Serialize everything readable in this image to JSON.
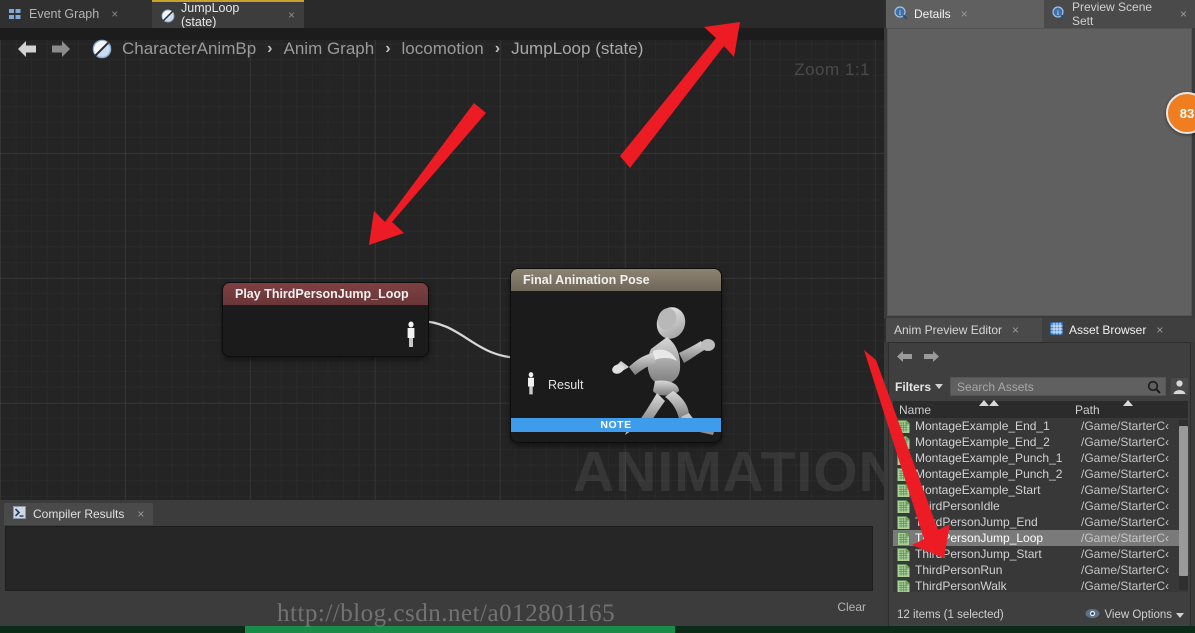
{
  "window": {
    "app": "Unreal Engine Animation Blueprint Editor"
  },
  "editor_tabs": [
    {
      "label": "Event Graph",
      "icon": "graph-grid-icon",
      "active": false,
      "close": "×"
    },
    {
      "label": "JumpLoop (state)",
      "icon": "state-circle-icon",
      "active": true,
      "close": "×"
    }
  ],
  "toolbar": {
    "back_icon": "back-arrow-icon",
    "forward_icon": "forward-arrow-icon",
    "zoom_label": "Zoom 1:1"
  },
  "breadcrumb": {
    "icon": "anim-blueprint-icon",
    "separator": "›",
    "items": [
      "CharacterAnimBp",
      "Anim Graph",
      "locomotion",
      "JumpLoop (state)"
    ]
  },
  "graph": {
    "watermark": "ANIMATION",
    "nodes": [
      {
        "id": "play-node",
        "title": "Play ThirdPersonJump_Loop",
        "output_pin": "pose-pin-icon"
      },
      {
        "id": "final-pose-node",
        "title": "Final Animation Pose",
        "input_pin_label": "Result",
        "input_pin": "pose-pin-icon",
        "footer_label": "NOTE",
        "footer_color": "#3f9bec",
        "preview": "running-mannequin"
      }
    ]
  },
  "compiler_results": {
    "tab_label": "Compiler Results",
    "tab_icon": "console-icon",
    "close": "×",
    "log_text": "",
    "clear_label": "Clear"
  },
  "details_panel": {
    "tabs": [
      {
        "label": "Details",
        "icon": "info-search-icon",
        "active": true,
        "close": "×"
      },
      {
        "label": "Preview Scene Sett",
        "icon": "info-search-icon",
        "active": false,
        "close": "×"
      }
    ],
    "content": ""
  },
  "badge": {
    "value": "83",
    "color": "#f07d20"
  },
  "asset_browser": {
    "tabs": [
      {
        "label": "Anim Preview Editor",
        "icon": "",
        "active": false,
        "close": "×"
      },
      {
        "label": "Asset Browser",
        "icon": "asset-grid-icon",
        "active": true,
        "close": "×"
      }
    ],
    "nav": {
      "back_icon": "back-arrow-icon",
      "forward_icon": "forward-arrow-icon"
    },
    "filters_label": "Filters",
    "search_placeholder": "Search Assets",
    "search_value": "",
    "search_icon": "magnifier-icon",
    "user_icon": "user-icon",
    "columns": [
      {
        "label": "Name",
        "sort": "ascending"
      },
      {
        "label": "Path",
        "sort": "ascending"
      }
    ],
    "rows": [
      {
        "name": "MontageExample_End_1",
        "path": "/Game/StarterC‹",
        "selected": false
      },
      {
        "name": "MontageExample_End_2",
        "path": "/Game/StarterC‹",
        "selected": false
      },
      {
        "name": "MontageExample_Punch_1",
        "path": "/Game/StarterC‹",
        "selected": false
      },
      {
        "name": "MontageExample_Punch_2",
        "path": "/Game/StarterC‹",
        "selected": false
      },
      {
        "name": "MontageExample_Start",
        "path": "/Game/StarterC‹",
        "selected": false
      },
      {
        "name": "ThirdPersonIdle",
        "path": "/Game/StarterC‹",
        "selected": false
      },
      {
        "name": "ThirdPersonJump_End",
        "path": "/Game/StarterC‹",
        "selected": false
      },
      {
        "name": "ThirdPersonJump_Loop",
        "path": "/Game/StarterC‹",
        "selected": true
      },
      {
        "name": "ThirdPersonJump_Start",
        "path": "/Game/StarterC‹",
        "selected": false
      },
      {
        "name": "ThirdPersonRun",
        "path": "/Game/StarterC‹",
        "selected": false
      },
      {
        "name": "ThirdPersonWalk",
        "path": "/Game/StarterC‹",
        "selected": false
      }
    ],
    "status": "12 items (1 selected)",
    "view_options_label": "View Options",
    "view_options_icon": "eye-icon"
  },
  "overlay": {
    "watermark_text": "http://blog.csdn.net/a012801165",
    "annotation_color": "#ed1c24",
    "annotations": [
      {
        "name": "arrow-to-play-node"
      },
      {
        "name": "arrow-to-jumploop-breadcrumb"
      },
      {
        "name": "arrow-to-selected-asset"
      }
    ]
  }
}
